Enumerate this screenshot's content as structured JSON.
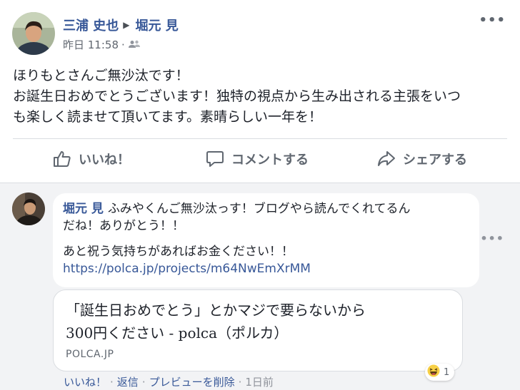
{
  "post": {
    "author": "三浦 史也",
    "recipient": "堀元 見",
    "time": "昨日 11:58",
    "body_lines": [
      "ほりもとさんご無沙汰です！",
      "お誕生日おめでとうございます！独特の視点から生み出される主張をいつ",
      "も楽しく読ませて頂いてます。素晴らしい一年を！"
    ],
    "actions": {
      "like": "いいね！",
      "comment": "コメントする",
      "share": "シェアする"
    }
  },
  "comment": {
    "author": "堀元 見",
    "text_line1": "ふみやくんご無沙汰っす！ブログやら読んでくれてるん",
    "text_line2": "だね！ありがとう！！",
    "text_line3": "あと祝う気持ちがあればお金ください！！",
    "link": "https://polca.jp/projects/m64NwEmXrMM",
    "preview": {
      "title_line1": "「誕生日おめでとう」とかマジで要らないから",
      "title_line2": "300円ください - polca（ポルカ）",
      "domain": "POLCA.JP"
    },
    "actions": {
      "like": "いいね！",
      "reply": "返信",
      "remove_preview": "プレビューを削除",
      "time": "1日前"
    },
    "reaction_count": "1"
  },
  "colors": {
    "link": "#385898",
    "muted": "#606770",
    "comment_bg": "#f2f3f5"
  }
}
